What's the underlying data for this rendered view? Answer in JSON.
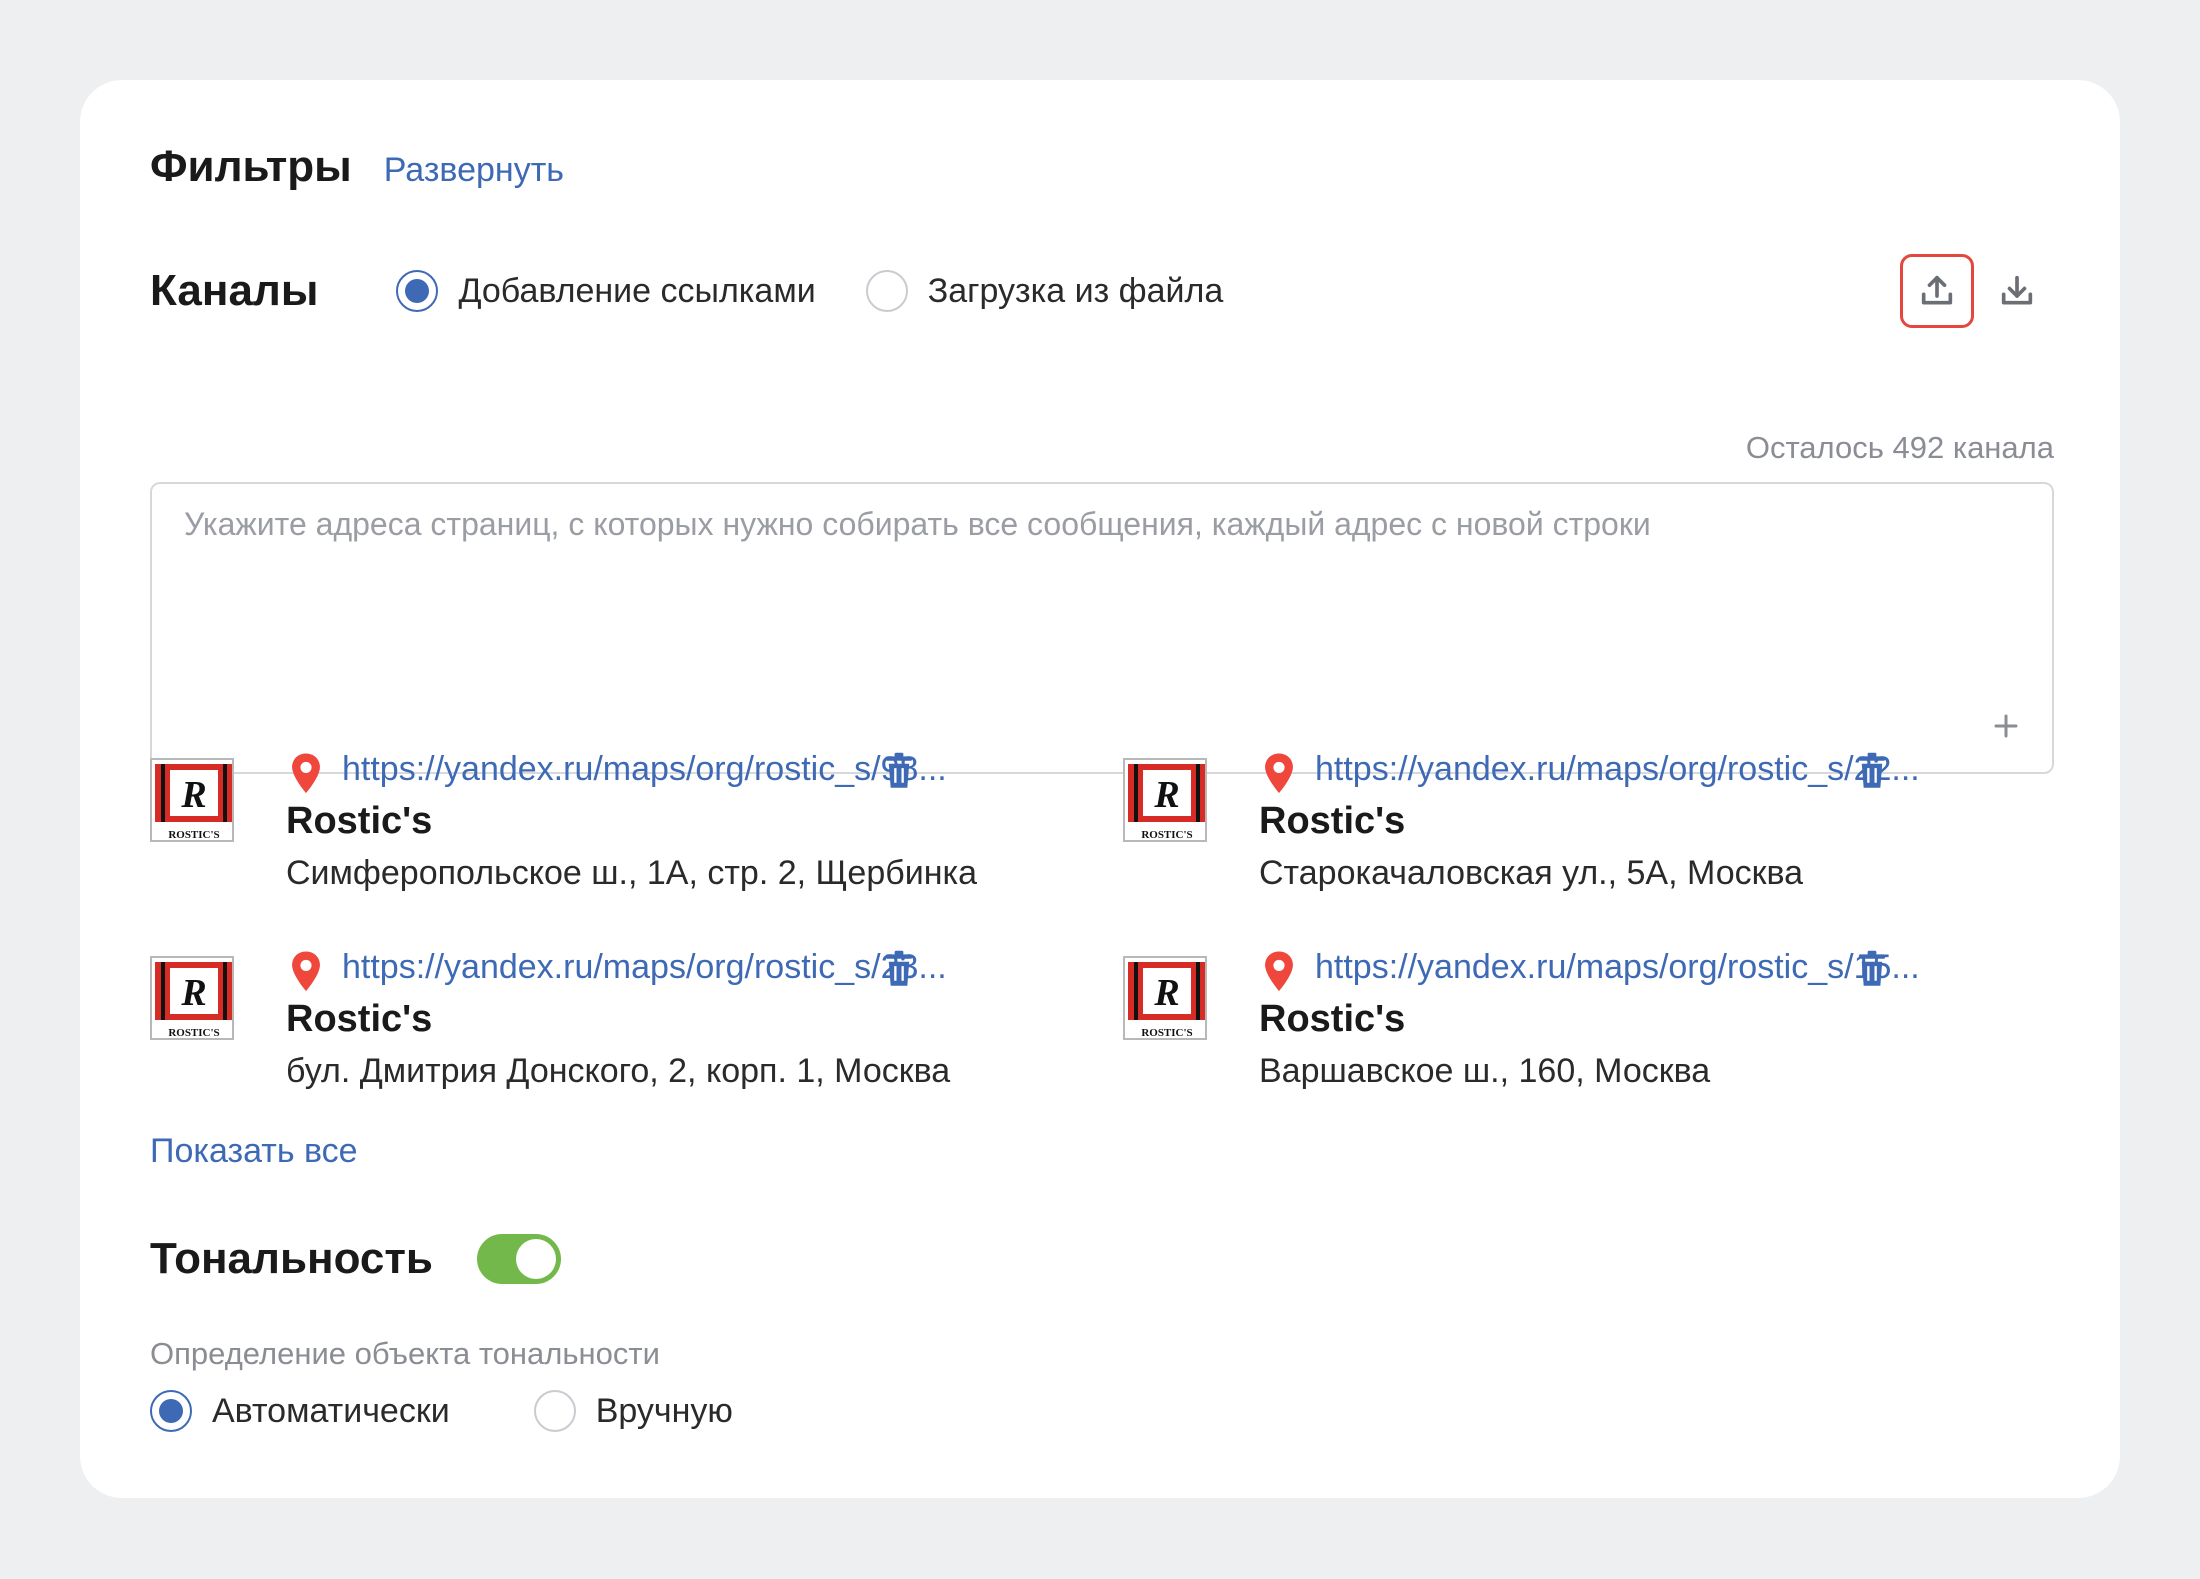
{
  "filters": {
    "title": "Фильтры",
    "expand_link": "Развернуть"
  },
  "channels": {
    "title": "Каналы",
    "mode_options": [
      {
        "label": "Добавление ссылками",
        "selected": true
      },
      {
        "label": "Загрузка из файла",
        "selected": false
      }
    ],
    "upload_icon": "upload-icon",
    "download_icon": "download-icon",
    "remaining_text": "Осталось 492 канала",
    "textarea": {
      "placeholder": "Укажите адреса страниц, с которых нужно собирать все сообщения, каждый адрес с новой строки",
      "value": ""
    },
    "items": [
      {
        "url": "https://yandex.ru/maps/org/rostic_s/98...",
        "name": "Rostic's",
        "address": "Симферопольское ш., 1А, стр. 2, Щербинка",
        "logo_text": "ROSTIC'S"
      },
      {
        "url": "https://yandex.ru/maps/org/rostic_s/22...",
        "name": "Rostic's",
        "address": "Старокачаловская ул., 5А, Москва",
        "logo_text": "ROSTIC'S"
      },
      {
        "url": "https://yandex.ru/maps/org/rostic_s/23...",
        "name": "Rostic's",
        "address": "бул. Дмитрия Донского, 2, корп. 1, Москва",
        "logo_text": "ROSTIC'S"
      },
      {
        "url": "https://yandex.ru/maps/org/rostic_s/15...",
        "name": "Rostic's",
        "address": "Варшавское ш., 160, Москва",
        "logo_text": "ROSTIC'S"
      }
    ],
    "show_all_link": "Показать все"
  },
  "tonality": {
    "title": "Тональность",
    "enabled": true,
    "object_label": "Определение объекта тональности",
    "options": [
      {
        "label": "Автоматически",
        "selected": true
      },
      {
        "label": "Вручную",
        "selected": false
      }
    ]
  },
  "colors": {
    "accent": "#3d69b5",
    "toggle_on": "#72b84a",
    "highlight": "#e5473f",
    "pin": "#f0473c"
  }
}
